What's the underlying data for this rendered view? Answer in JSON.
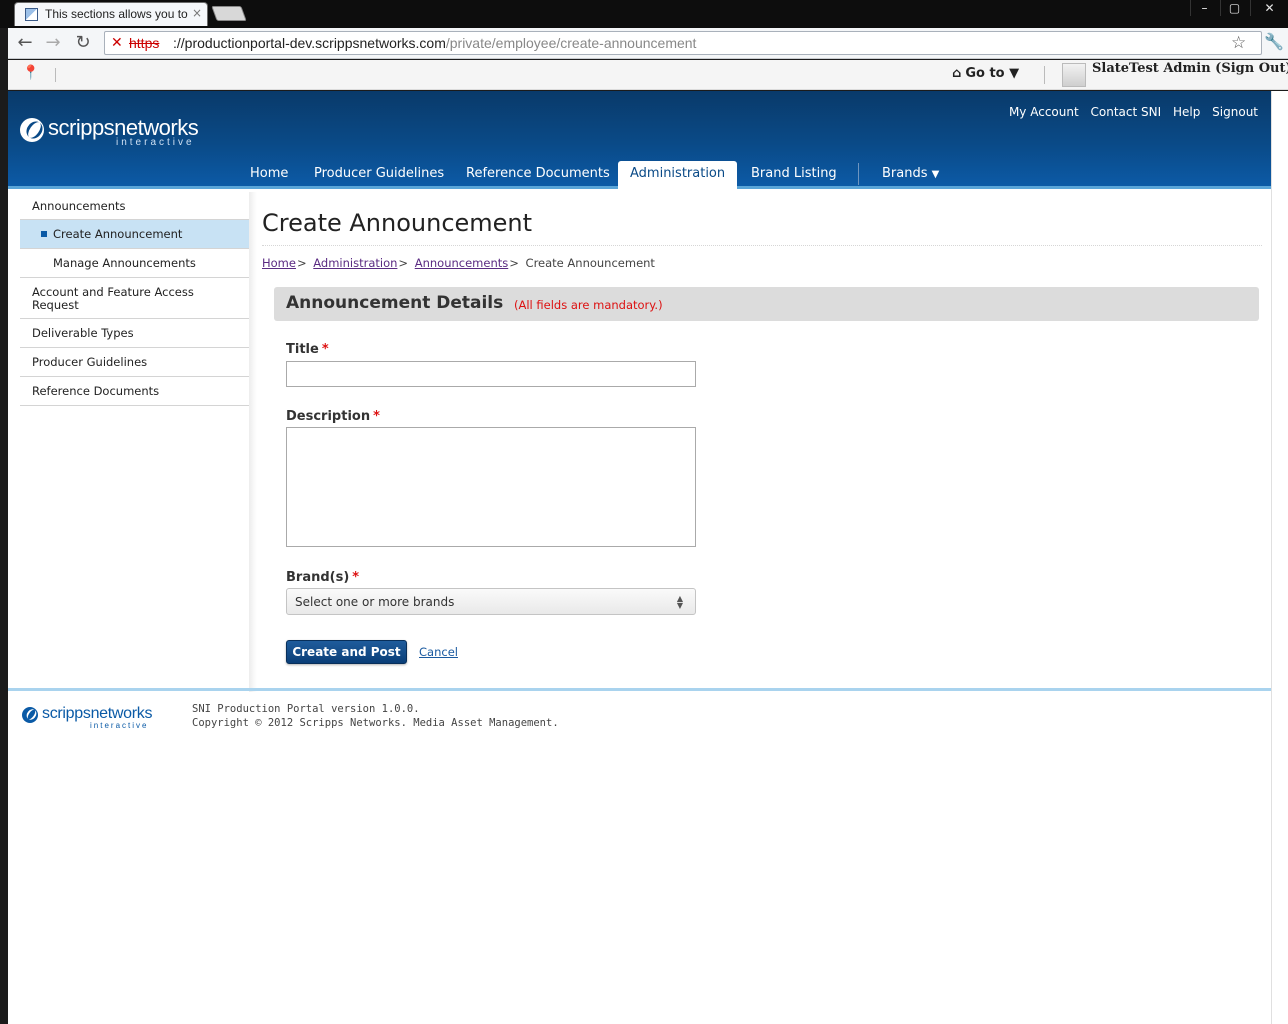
{
  "browser": {
    "tab_title": "This sections allows you to",
    "tab_close": "×",
    "url_scheme": "https",
    "url_host": "://productionportal-dev.scrippsnetworks.com",
    "url_path": "/private/employee/create-announcement",
    "window_buttons": [
      "–",
      "▢",
      "✕"
    ]
  },
  "extbar": {
    "goto_label": "Go to",
    "user_label": "SlateTest Admin (Sign Out)"
  },
  "header": {
    "logo_main": "scrippsnetworks",
    "logo_sub": "interactive",
    "utility_links": [
      "My Account",
      "Contact SNI",
      "Help",
      "Signout"
    ],
    "nav": [
      "Home",
      "Producer Guidelines",
      "Reference Documents",
      "Administration",
      "Brand Listing",
      "Brands"
    ],
    "active_nav": "Administration"
  },
  "sidebar": {
    "items": [
      {
        "label": "Announcements"
      },
      {
        "label": "Create Announcement"
      },
      {
        "label": "Manage Announcements"
      },
      {
        "label": "Account and Feature Access Request"
      },
      {
        "label": "Deliverable Types"
      },
      {
        "label": "Producer Guidelines"
      },
      {
        "label": "Reference Documents"
      }
    ]
  },
  "main": {
    "title": "Create Announcement",
    "breadcrumb": [
      "Home",
      "Administration",
      "Announcements",
      "Create Announcement"
    ],
    "breadcrumb_sep": ">",
    "section_title": "Announcement Details",
    "section_note": "(All fields are mandatory.)",
    "required_mark": "*",
    "fields": {
      "title_label": "Title",
      "title_value": "",
      "description_label": "Description",
      "description_value": "",
      "brands_label": "Brand(s)",
      "brands_placeholder": "Select one or more brands"
    },
    "submit_label": "Create and Post",
    "cancel_label": "Cancel"
  },
  "footer": {
    "logo_main": "scrippsnetworks",
    "logo_sub": "interactive",
    "version": "SNI Production Portal version 1.0.0.",
    "copyright": "Copyright © 2012 Scripps Networks. Media Asset Management."
  },
  "colors": {
    "header_blue": "#0a4a87",
    "accent_light_blue": "#a9d3ee",
    "required_red": "#dd1111",
    "active_sidebar": "#c8e2f4"
  }
}
